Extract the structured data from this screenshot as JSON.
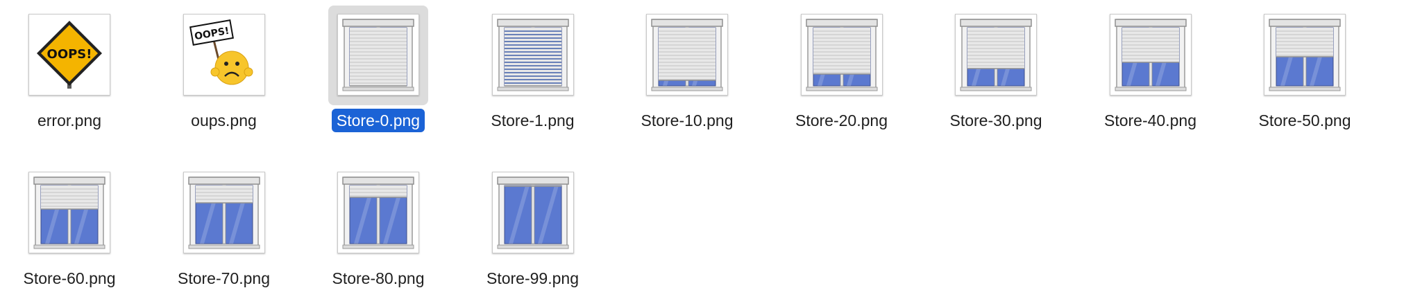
{
  "folder": {
    "items": [
      {
        "name": "error.png",
        "kind": "oops-sign",
        "open_percent": 0,
        "selected": false
      },
      {
        "name": "oups.png",
        "kind": "oops-smiley",
        "open_percent": 0,
        "selected": false
      },
      {
        "name": "Store-0.png",
        "kind": "shutter",
        "open_percent": 0,
        "selected": true
      },
      {
        "name": "Store-1.png",
        "kind": "shutter-slats",
        "open_percent": 1,
        "selected": false
      },
      {
        "name": "Store-10.png",
        "kind": "shutter",
        "open_percent": 10,
        "selected": false
      },
      {
        "name": "Store-20.png",
        "kind": "shutter",
        "open_percent": 20,
        "selected": false
      },
      {
        "name": "Store-30.png",
        "kind": "shutter",
        "open_percent": 30,
        "selected": false
      },
      {
        "name": "Store-40.png",
        "kind": "shutter",
        "open_percent": 40,
        "selected": false
      },
      {
        "name": "Store-50.png",
        "kind": "shutter",
        "open_percent": 50,
        "selected": false
      },
      {
        "name": "Store-60.png",
        "kind": "shutter",
        "open_percent": 60,
        "selected": false
      },
      {
        "name": "Store-70.png",
        "kind": "shutter",
        "open_percent": 70,
        "selected": false
      },
      {
        "name": "Store-80.png",
        "kind": "shutter",
        "open_percent": 80,
        "selected": false
      },
      {
        "name": "Store-99.png",
        "kind": "shutter",
        "open_percent": 99,
        "selected": false
      }
    ],
    "colors": {
      "selection": "#1b63d6",
      "glass": "#5b79d0",
      "shutter": "#e8e8e8",
      "sign": "#f4b400"
    },
    "sign_text": "OOPS!"
  }
}
